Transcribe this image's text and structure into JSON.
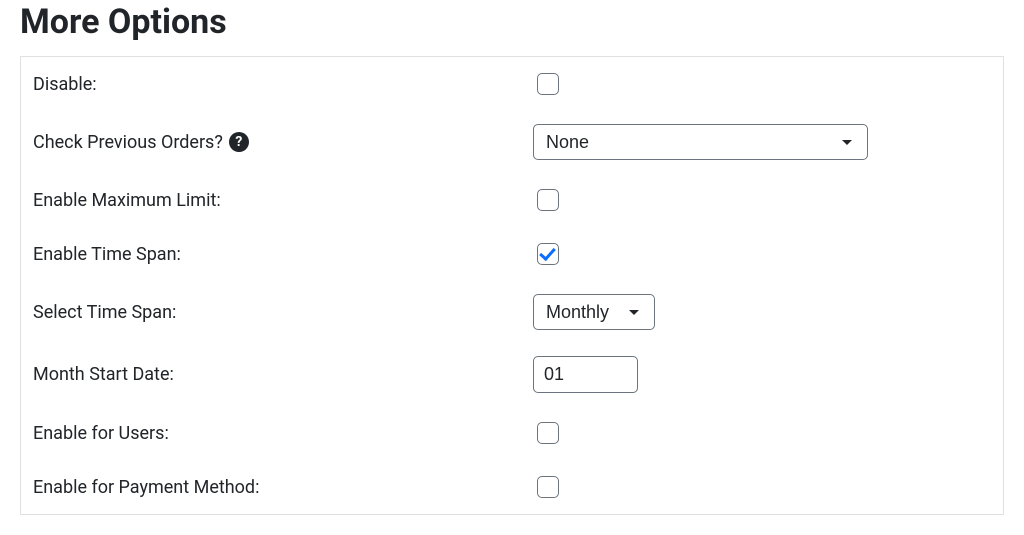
{
  "section": {
    "title": "More Options"
  },
  "rows": {
    "disable": {
      "label": "Disable:",
      "checked": false
    },
    "check_previous_orders": {
      "label": "Check Previous Orders?",
      "help": "?",
      "select": {
        "value": "None",
        "options": [
          "None"
        ]
      }
    },
    "enable_maximum_limit": {
      "label": "Enable Maximum Limit:",
      "checked": false
    },
    "enable_time_span": {
      "label": "Enable Time Span:",
      "checked": true
    },
    "select_time_span": {
      "label": "Select Time Span:",
      "select": {
        "value": "Monthly",
        "options": [
          "Monthly"
        ]
      }
    },
    "month_start_date": {
      "label": "Month Start Date:",
      "value": "01"
    },
    "enable_for_users": {
      "label": "Enable for Users:",
      "checked": false
    },
    "enable_for_payment_method": {
      "label": "Enable for Payment Method:",
      "checked": false
    }
  }
}
